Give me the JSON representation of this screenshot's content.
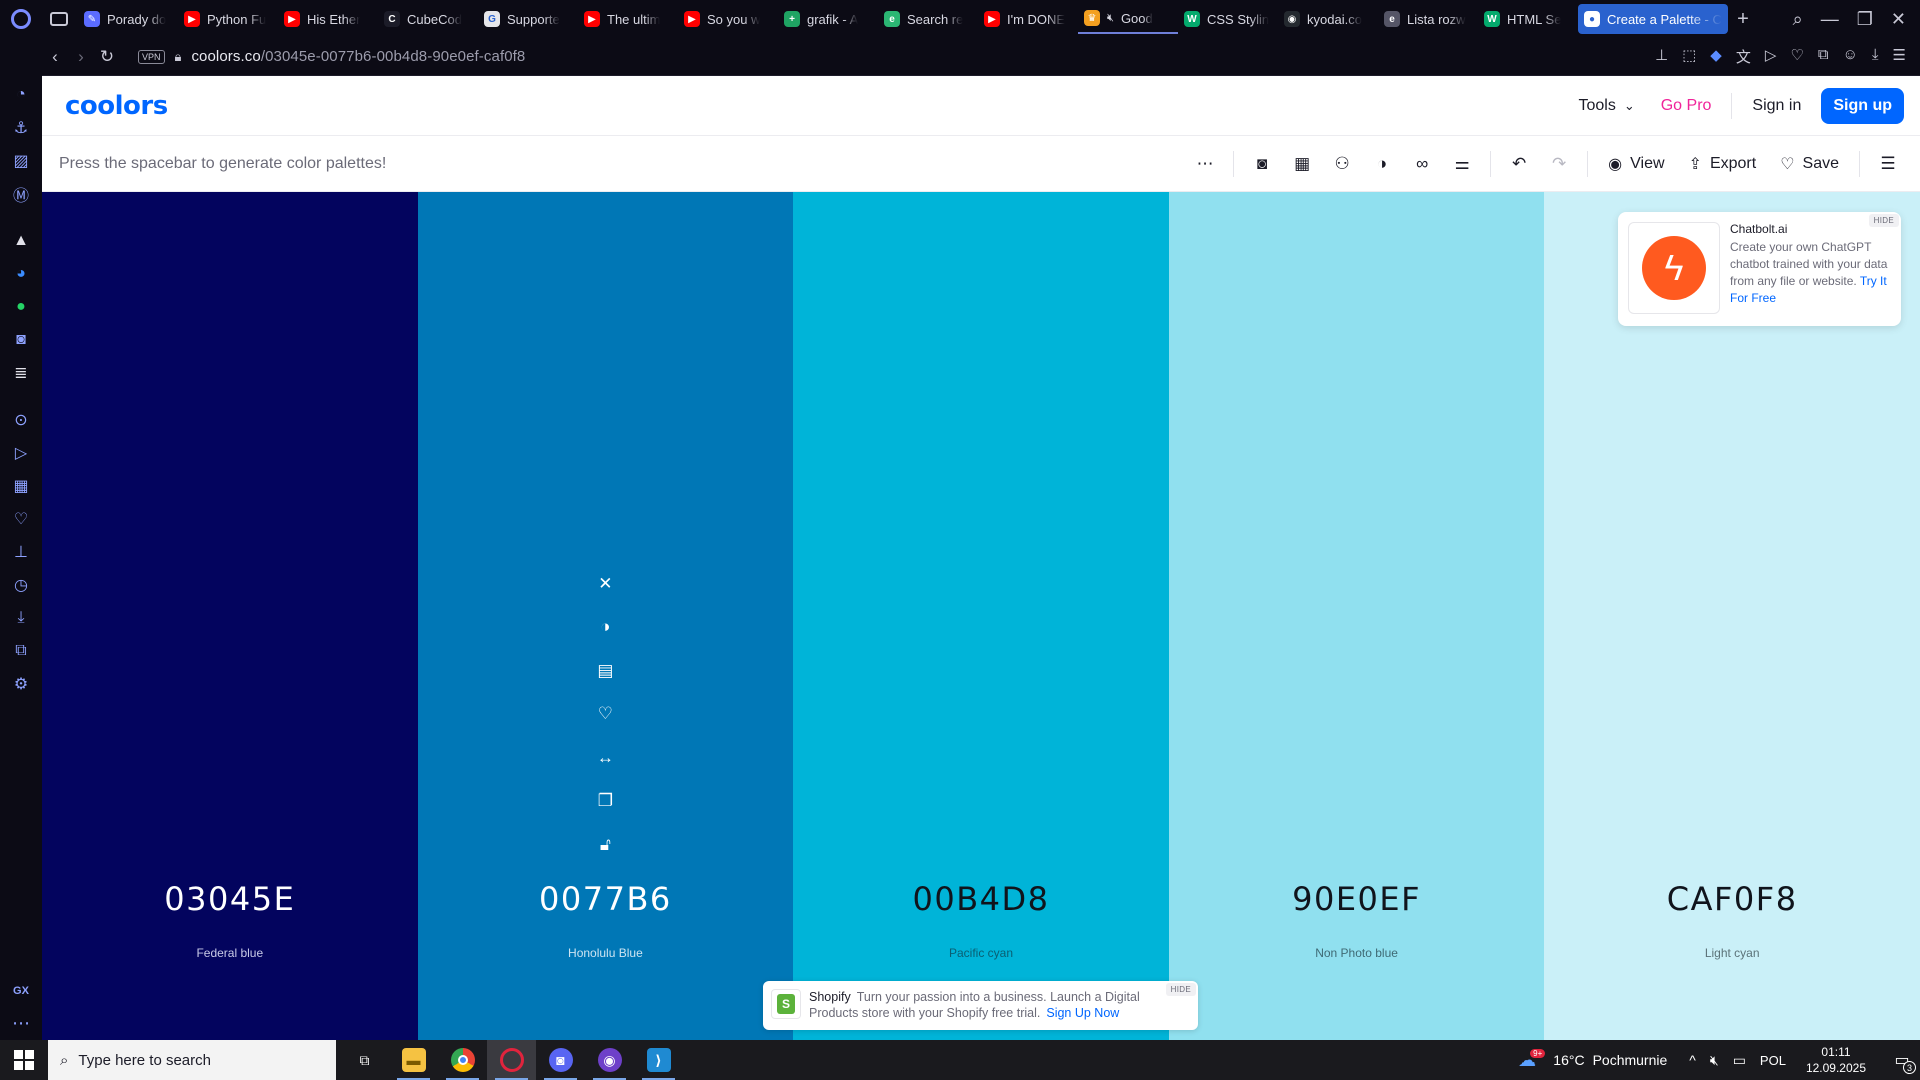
{
  "browser": {
    "tabs": [
      {
        "title": "Porady do",
        "icon": "generic-tab-icon",
        "color": "#5b6cff",
        "glyph": "✎"
      },
      {
        "title": "Python Fu",
        "icon": "youtube-icon",
        "color": "#ff0000",
        "glyph": "▶"
      },
      {
        "title": "His Ether",
        "icon": "youtube-icon",
        "color": "#ff0000",
        "glyph": "▶"
      },
      {
        "title": "CubeCod",
        "icon": "cubecoders-icon",
        "color": "#1c1c28",
        "glyph": "C"
      },
      {
        "title": "Supporte",
        "icon": "google-icon",
        "color": "#e6e6ea",
        "glyph": "G"
      },
      {
        "title": "The ultim",
        "icon": "youtube-icon",
        "color": "#ff0000",
        "glyph": "▶"
      },
      {
        "title": "So you w",
        "icon": "youtube-icon",
        "color": "#ff0000",
        "glyph": "▶"
      },
      {
        "title": "grafik - A",
        "icon": "sheets-icon",
        "color": "#1fa463",
        "glyph": "+"
      },
      {
        "title": "Search re",
        "icon": "search-result-icon",
        "color": "#2bb673",
        "glyph": "e"
      },
      {
        "title": "I'm DONE",
        "icon": "youtube-icon",
        "color": "#ff0000",
        "glyph": "▶"
      },
      {
        "title": "Good",
        "icon": "muted-audio-icon",
        "color": "#f4a020",
        "glyph": "♛",
        "muted": true
      },
      {
        "title": "CSS Stylin",
        "icon": "w3schools-icon",
        "color": "#04aa6d",
        "glyph": "W"
      },
      {
        "title": "kyodai.co",
        "icon": "github-icon",
        "color": "#24292f",
        "glyph": "◉"
      },
      {
        "title": "Lista rozw",
        "icon": "etc-icon",
        "color": "#555566",
        "glyph": "e"
      },
      {
        "title": "HTML Se",
        "icon": "w3schools-icon",
        "color": "#04aa6d",
        "glyph": "W"
      },
      {
        "title": "Create a Palette - C",
        "icon": "coolors-icon",
        "color": "#ffffff",
        "glyph": "●",
        "active": true
      }
    ],
    "url_host": "coolors.co",
    "url_path": "/03045e-0077b6-00b4d8-90e0ef-caf0f8",
    "vpn_label": "VPN"
  },
  "app": {
    "logo": "coolors",
    "tools_label": "Tools",
    "gopro_label": "Go Pro",
    "signin_label": "Sign in",
    "signup_label": "Sign up",
    "hint": "Press the spacebar to generate color palettes!",
    "view_label": "View",
    "export_label": "Export",
    "save_label": "Save",
    "brand_color": "#0066ff",
    "gopro_color": "#f0249a"
  },
  "palette": [
    {
      "hex": "03045E",
      "name": "Federal blue",
      "color": "#03045e",
      "text_color": "#ffffff",
      "name_color": "#c9cbe8"
    },
    {
      "hex": "0077B6",
      "name": "Honolulu Blue",
      "color": "#0077b6",
      "text_color": "#ffffff",
      "name_color": "#cde4f2",
      "hovered": true
    },
    {
      "hex": "00B4D8",
      "name": "Pacific cyan",
      "color": "#00b4d8",
      "text_color": "#10141c",
      "name_color": "#0a5f73"
    },
    {
      "hex": "90E0EF",
      "name": "Non Photo blue",
      "color": "#90e0ef",
      "text_color": "#10141c",
      "name_color": "#3f6a74"
    },
    {
      "hex": "CAF0F8",
      "name": "Light cyan",
      "color": "#caf0f8",
      "text_color": "#10141c",
      "name_color": "#5b7278"
    }
  ],
  "ads": {
    "chatbolt": {
      "title": "Chatbolt.ai",
      "text": "Create your own ChatGPT chatbot trained with your data from any file or website.",
      "cta": "Try It For Free",
      "hide": "HIDE"
    },
    "shopify": {
      "name": "Shopify",
      "text": "Turn your passion into a business. Launch a Digital Products store with your Shopify free trial.",
      "cta": "Sign Up Now",
      "hide": "HIDE"
    }
  },
  "taskbar": {
    "search_placeholder": "Type here to search",
    "weather_temp": "16°C",
    "weather_desc": "Pochmurnie",
    "weather_badge": "9+",
    "lang": "POL",
    "time": "01:11",
    "date": "12.09.2025",
    "notifications": "3"
  }
}
